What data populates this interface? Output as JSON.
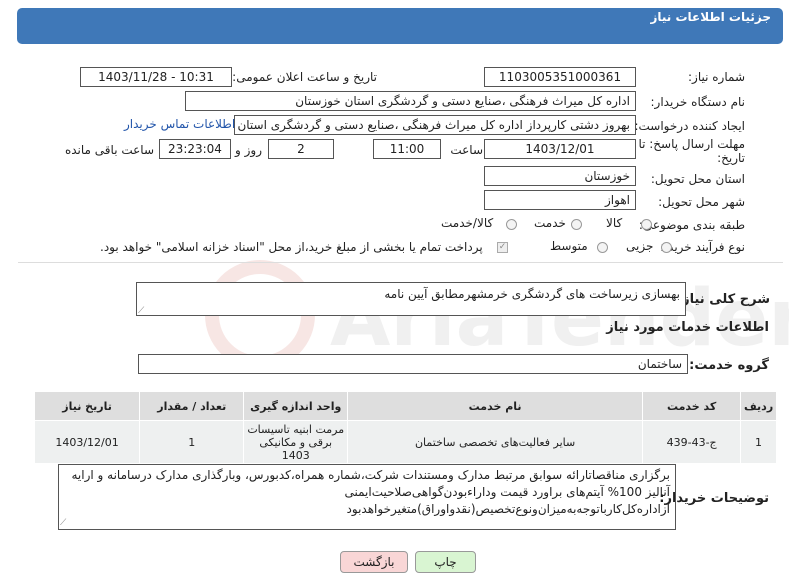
{
  "header": {
    "title": "جزئیات اطلاعات نیاز"
  },
  "fields": {
    "need_number_label": "شماره نیاز:",
    "need_number": "1103005351000361",
    "announce_label": "تاریخ و ساعت اعلان عمومی:",
    "announce_value": "1403/11/28 - 10:31",
    "buyer_org_label": "نام دستگاه خریدار:",
    "buyer_org": "اداره کل میراث فرهنگی ،صنایع دستی و گردشگری استان خوزستان",
    "creator_label": "ایجاد کننده درخواست:",
    "creator": "بهروز دشتی کارپرداز اداره کل میراث فرهنگی ،صنایع دستی و گردشگری استان خوزستان",
    "contact_link": "اطلاعات تماس خریدار",
    "deadline_label_1": "مهلت ارسال پاسخ: تا",
    "deadline_label_2": "تاریخ:",
    "deadline_date": "1403/12/01",
    "hour_label": "ساعت",
    "deadline_time": "11:00",
    "days_value": "2",
    "days_label": "روز و",
    "remaining_time": "23:23:04",
    "remaining_label": "ساعت باقی مانده",
    "province_label": "استان محل تحویل:",
    "province": "خوزستان",
    "city_label": "شهر محل تحویل:",
    "city": "اهواز",
    "category_label": "طبقه بندی موضوعی:",
    "category_options": [
      "کالا",
      "خدمت",
      "کالا/خدمت"
    ],
    "process_label": "نوع فرآیند خرید :",
    "process_options": [
      "جزیی",
      "متوسط"
    ],
    "payment_note": "پرداخت تمام یا بخشی از مبلغ خرید،از محل \"اسناد خزانه اسلامی\" خواهد بود."
  },
  "summary": {
    "label": "شرح کلی نیاز:",
    "text": "بهسازی زیرساخت های گردشگری خرمشهرمطابق آیین نامه"
  },
  "services": {
    "section_title": "اطلاعات خدمات مورد نیاز",
    "group_label": "گروه خدمت:",
    "group_value": "ساختمان",
    "columns": [
      "ردیف",
      "کد خدمت",
      "نام خدمت",
      "واحد اندازه گیری",
      "تعداد / مقدار",
      "تاریخ نیاز"
    ],
    "rows": [
      {
        "row": "1",
        "code": "ج-43-439",
        "name": "سایر فعالیت‌های تخصصی ساختمان",
        "unit": "مرمت ابنیه تاسیسات برقی و مکانیکی 1403",
        "qty": "1",
        "date": "1403/12/01"
      }
    ]
  },
  "buyer_notes": {
    "label": "توضیحات خریدار:",
    "text": "برگزاری مناقصاتارائه سوابق مرتبط مدارک ومستندات شرکت،شماره همراه،کدبورس، وبارگذاری مدارک درسامانه و ارایه آنالیز 100% آیتم‌های براورد قیمت وداراءبودن‌گواهی‌صلاحیت‌ایمنی ازاداره‌کل‌کارباتوجه‌به‌میزان‌ونوع‌تخصیص(نقدواوراق)متغیرخواهدبود"
  },
  "buttons": {
    "print": "چاپ",
    "back": "بازگشت"
  },
  "watermark": {
    "text": "AriaTender.neT"
  },
  "colors": {
    "header": "#3f78b8",
    "link": "#2255aa",
    "print_btn": "#d9f5d2",
    "back_btn": "#f9d6d6"
  }
}
